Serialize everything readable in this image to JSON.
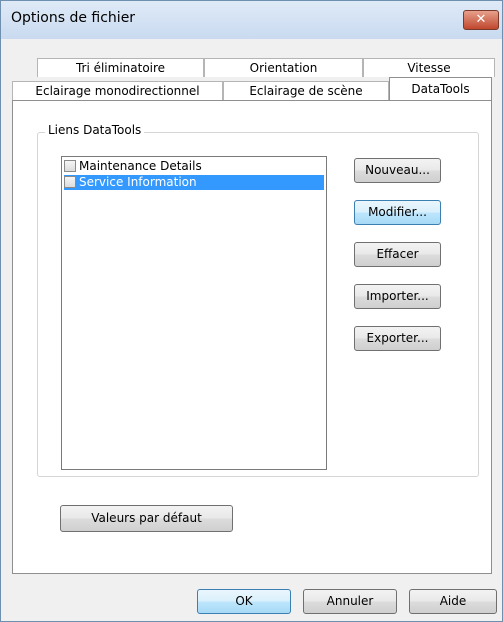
{
  "window": {
    "title": "Options de fichier",
    "close_glyph": "✕"
  },
  "tabs": {
    "back_row": [
      "Tri éliminatoire",
      "Orientation",
      "Vitesse"
    ],
    "front_row": [
      "Eclairage monodirectionnel",
      "Eclairage de scène",
      "DataTools"
    ],
    "selected": "DataTools"
  },
  "group": {
    "label": "Liens DataTools",
    "items": [
      {
        "label": "Maintenance Details",
        "checked": false,
        "selected": false
      },
      {
        "label": "Service Information",
        "checked": false,
        "selected": true
      }
    ]
  },
  "side_buttons": {
    "new": "Nouveau...",
    "modify": "Modifier...",
    "delete": "Effacer",
    "import": "Importer...",
    "export": "Exporter..."
  },
  "defaults_button": "Valeurs par défaut",
  "footer": {
    "ok": "OK",
    "cancel": "Annuler",
    "help": "Aide"
  },
  "colors": {
    "selection": "#3399ff",
    "focus_border": "#3c7fb1"
  }
}
